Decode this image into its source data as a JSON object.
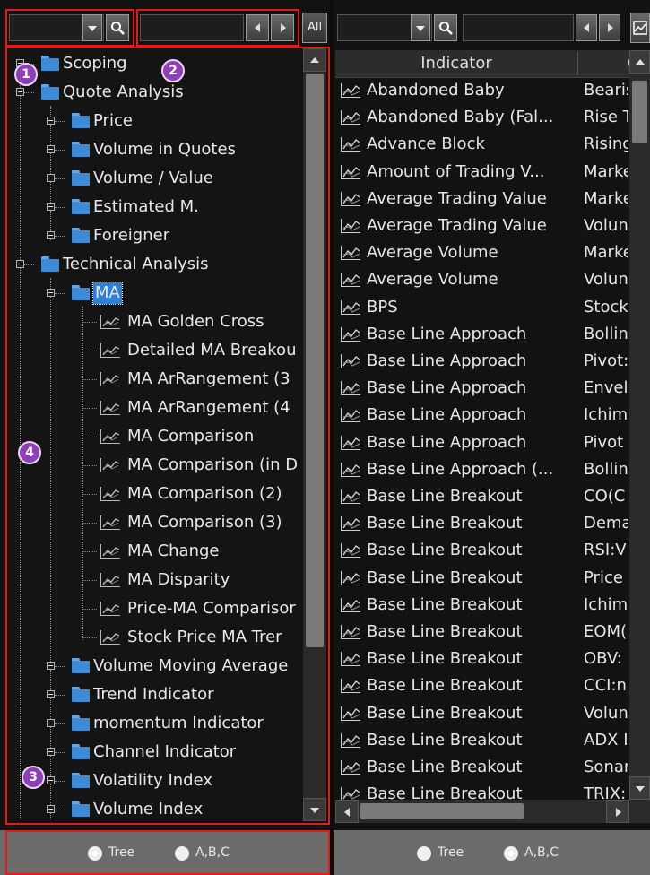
{
  "left": {
    "all_button": "All",
    "tree": [
      {
        "label": "Scoping"
      },
      {
        "label": "Quote Analysis"
      },
      {
        "label": "Price"
      },
      {
        "label": "Volume in Quotes"
      },
      {
        "label": "Volume / Value"
      },
      {
        "label": "Estimated M."
      },
      {
        "label": "Foreigner"
      },
      {
        "label": "Technical Analysis"
      },
      {
        "label": "MA"
      },
      {
        "label": "MA Golden Cross"
      },
      {
        "label": "Detailed MA Breakou"
      },
      {
        "label": "MA ArRangement (3"
      },
      {
        "label": "MA ArRangement (4"
      },
      {
        "label": "MA Comparison"
      },
      {
        "label": "MA Comparison (in D"
      },
      {
        "label": "MA Comparison (2)"
      },
      {
        "label": "MA Comparison (3)"
      },
      {
        "label": "MA Change"
      },
      {
        "label": "MA Disparity"
      },
      {
        "label": "Price-MA Comparisor"
      },
      {
        "label": "Stock Price MA Trer"
      },
      {
        "label": "Volume Moving Average"
      },
      {
        "label": "Trend Indicator"
      },
      {
        "label": "momentum Indicator"
      },
      {
        "label": "Channel Indicator"
      },
      {
        "label": "Volatility Index"
      },
      {
        "label": "Volume Index"
      }
    ],
    "radio": {
      "tree": "Tree",
      "abc": "A,B,C",
      "selected": "tree"
    }
  },
  "badges": [
    "1",
    "2",
    "3",
    "4"
  ],
  "right": {
    "header": {
      "indicator": "Indicator",
      "second": "C"
    },
    "rows": [
      {
        "name": "Abandoned Baby",
        "cat": "Bearis"
      },
      {
        "name": "Abandoned Baby (Fal...",
        "cat": "Rise T"
      },
      {
        "name": "Advance Block",
        "cat": "Rising"
      },
      {
        "name": "Amount of Trading V...",
        "cat": "Marke"
      },
      {
        "name": "Average Trading Value",
        "cat": "Marke"
      },
      {
        "name": "Average Trading Value",
        "cat": "Volun"
      },
      {
        "name": "Average Volume",
        "cat": "Marke"
      },
      {
        "name": "Average Volume",
        "cat": "Volun"
      },
      {
        "name": "BPS",
        "cat": "Stock"
      },
      {
        "name": "Base Line Approach",
        "cat": "Bollin"
      },
      {
        "name": "Base Line Approach",
        "cat": "Pivot:"
      },
      {
        "name": "Base Line Approach",
        "cat": "Envel"
      },
      {
        "name": "Base Line Approach",
        "cat": "Ichim"
      },
      {
        "name": "Base Line Approach",
        "cat": "Pivot"
      },
      {
        "name": "Base Line Approach (...",
        "cat": "Bollin"
      },
      {
        "name": "Base Line Breakout",
        "cat": "CO(C"
      },
      {
        "name": "Base Line Breakout",
        "cat": "Dema"
      },
      {
        "name": "Base Line Breakout",
        "cat": "RSI:V"
      },
      {
        "name": "Base Line Breakout",
        "cat": "Price"
      },
      {
        "name": "Base Line Breakout",
        "cat": "Ichim"
      },
      {
        "name": "Base Line Breakout",
        "cat": "EOM("
      },
      {
        "name": "Base Line Breakout",
        "cat": "OBV:"
      },
      {
        "name": "Base Line Breakout",
        "cat": "CCI:n"
      },
      {
        "name": "Base Line Breakout",
        "cat": "Volun"
      },
      {
        "name": "Base Line Breakout",
        "cat": "ADX I"
      },
      {
        "name": "Base Line Breakout",
        "cat": "Sonar"
      },
      {
        "name": "Base Line Breakout",
        "cat": "TRIX:"
      }
    ],
    "radio": {
      "tree": "Tree",
      "abc": "A,B,C",
      "selected": "abc"
    }
  }
}
